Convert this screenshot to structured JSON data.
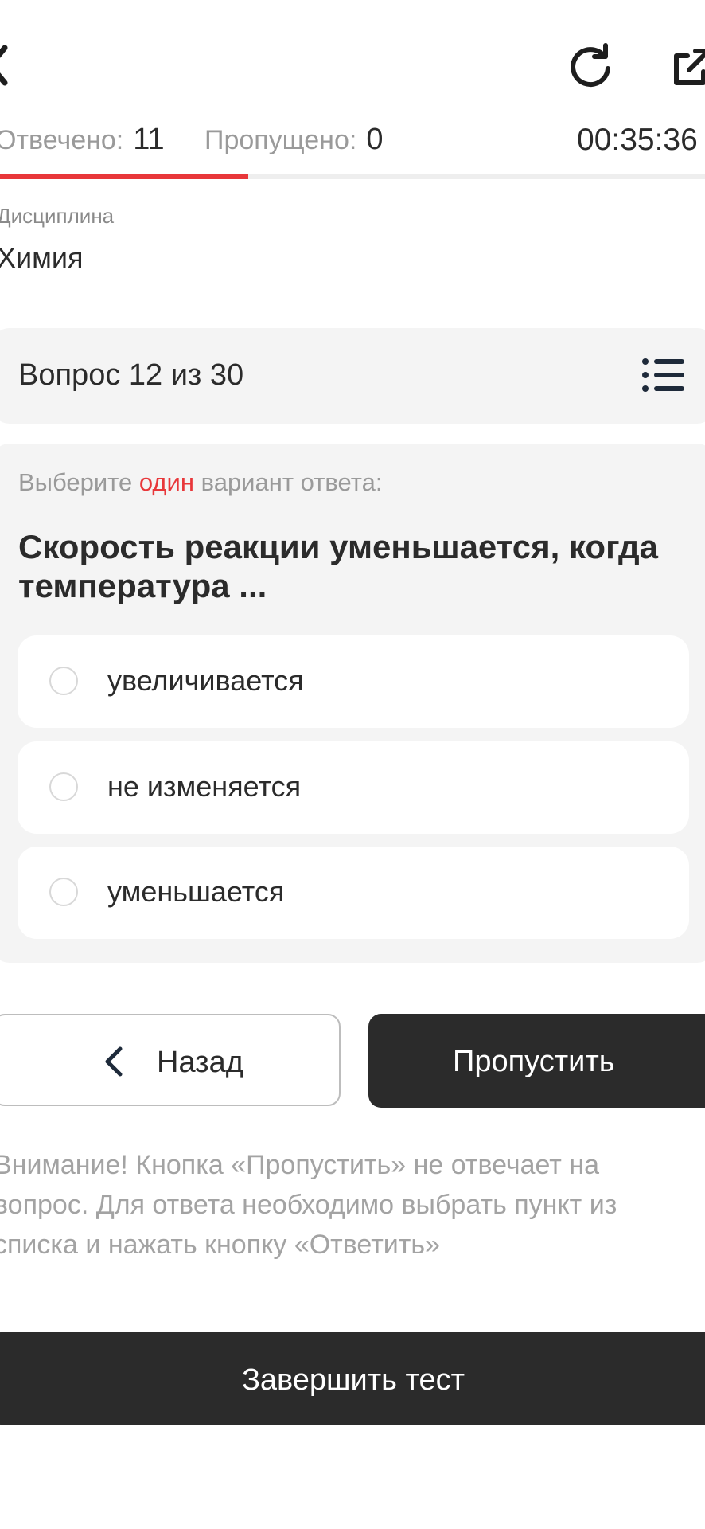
{
  "header": {
    "back_icon": "chevron-left-icon",
    "refresh_icon": "refresh-icon",
    "external_icon": "external-link-icon"
  },
  "stats": {
    "answered_label": "Отвечено:",
    "answered_value": "11",
    "skipped_label": "Пропущено:",
    "skipped_value": "0",
    "timer": "00:35:36"
  },
  "progress": {
    "fraction": 0.353,
    "track_color": "#eeeeee",
    "fill_color": "#e8373a"
  },
  "discipline": {
    "label": "Дисциплина",
    "value": "Химия"
  },
  "question_header": {
    "title": "Вопрос 12 из 30",
    "list_icon": "list-icon"
  },
  "question": {
    "hint_before": "Выберите ",
    "hint_accent": "один",
    "hint_after": " вариант ответа:",
    "text": "Скорость реакции уменьшается, когда температура ...",
    "options": [
      {
        "label": "увеличивается",
        "selected": false
      },
      {
        "label": "не изменяется",
        "selected": false
      },
      {
        "label": "уменьшается",
        "selected": false
      }
    ]
  },
  "buttons": {
    "back_label": "Назад",
    "skip_label": "Пропустить",
    "finish_label": "Завершить тест"
  },
  "notice": "Внимание! Кнопка «Пропустить» не отвечает на вопрос. Для ответа необходимо выбрать пункт из списка и нажать кнопку «Ответить»",
  "colors": {
    "accent": "#e8373a",
    "dark_button": "#2b2b2b",
    "panel": "#f4f4f4"
  }
}
